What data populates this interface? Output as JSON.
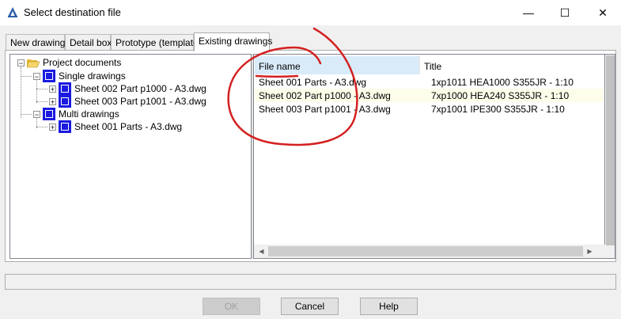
{
  "window": {
    "title": "Select destination file",
    "minimize_glyph": "—",
    "maximize_glyph": "☐",
    "close_glyph": "✕"
  },
  "tabs": [
    {
      "label": "New drawing",
      "active": false
    },
    {
      "label": "Detail box",
      "active": false
    },
    {
      "label": "Prototype (template)",
      "active": false
    },
    {
      "label": "Existing drawings",
      "active": true
    }
  ],
  "tree": {
    "root": {
      "label": "Project documents",
      "expander": "−"
    },
    "groups": [
      {
        "label": "Single drawings",
        "expander": "−",
        "children": [
          {
            "label": "Sheet 002 Part p1000 - A3.dwg",
            "expander": "+"
          },
          {
            "label": "Sheet 003 Part p1001 - A3.dwg",
            "expander": "+"
          }
        ]
      },
      {
        "label": "Multi drawings",
        "expander": "−",
        "children": [
          {
            "label": "Sheet 001 Parts - A3.dwg",
            "expander": "+"
          }
        ]
      }
    ]
  },
  "list": {
    "columns": [
      "File name",
      "Title"
    ],
    "rows": [
      {
        "file": "Sheet 001 Parts - A3.dwg",
        "title": "1xp1011 HEA1000 S355JR - 1:10",
        "highlight": false
      },
      {
        "file": "Sheet 002 Part p1000 - A3.dwg",
        "title": "7xp1000 HEA240 S355JR - 1:10",
        "highlight": true
      },
      {
        "file": "Sheet 003 Part p1001 - A3.dwg",
        "title": "7xp1001 IPE300 S355JR - 1:10",
        "highlight": false
      }
    ]
  },
  "buttons": {
    "ok": "OK",
    "cancel": "Cancel",
    "help": "Help"
  },
  "colors": {
    "annotation": "#d42020",
    "selected_header": "#d9ebf9",
    "doc_icon": "#1a1ae0"
  }
}
